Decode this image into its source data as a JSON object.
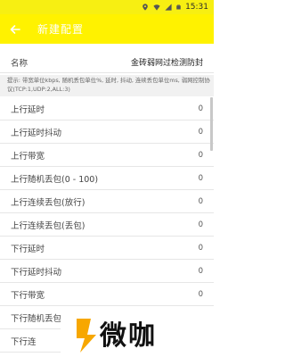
{
  "status_bar": {
    "time": "15:31"
  },
  "app_bar": {
    "title": "新建配置"
  },
  "name_field": {
    "label": "名称",
    "value": "金砖弱网过检测防封"
  },
  "hint": "提示: 带宽单位kbps, 随机丢包单位%, 延时, 抖动, 连续丢包单位ms, 弱网控制协议(TCP:1,UDP:2,ALL:3)",
  "rows": [
    {
      "label": "上行延时",
      "value": "0"
    },
    {
      "label": "上行延时抖动",
      "value": "0"
    },
    {
      "label": "上行带宽",
      "value": "0"
    },
    {
      "label": "上行随机丢包(0 - 100)",
      "value": "0"
    },
    {
      "label": "上行连续丢包(放行)",
      "value": "0"
    },
    {
      "label": "上行连续丢包(丢包)",
      "value": "0"
    },
    {
      "label": "下行延时",
      "value": "0"
    },
    {
      "label": "下行延时抖动",
      "value": "0"
    },
    {
      "label": "下行带宽",
      "value": "0"
    },
    {
      "label": "下行随机丢包(0 - 100)",
      "value": "0"
    },
    {
      "label": "下行连",
      "value": ""
    }
  ],
  "watermark": {
    "text": "微咖"
  },
  "colors": {
    "accent": "#fff200",
    "status_bar": "#f7ef12",
    "watermark_mark": "#f7a700"
  }
}
